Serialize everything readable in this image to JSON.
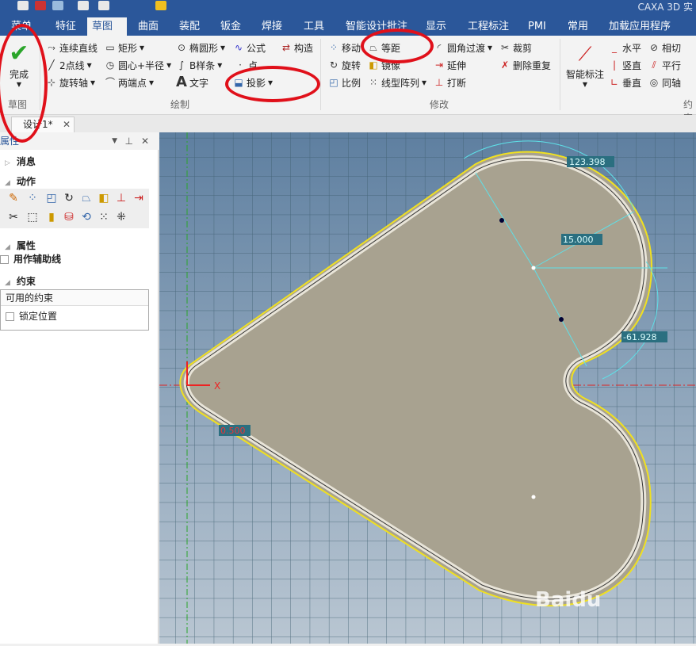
{
  "app": {
    "title": "CAXA 3D 实"
  },
  "menu_tabs": [
    "菜单",
    "特征",
    "草图",
    "曲面",
    "装配",
    "钣金",
    "焊接",
    "工具",
    "智能设计批注",
    "显示",
    "工程标注",
    "PMI",
    "常用",
    "加载应用程序"
  ],
  "ribbon": {
    "finish": "完成",
    "sketch_group": "草图",
    "draw": [
      "连续直线",
      "矩形",
      "椭圆形",
      "公式",
      "构造",
      "2点线",
      "圆心+半径",
      "B样条",
      "点",
      "旋转轴",
      "两端点",
      "文字",
      "投影"
    ],
    "draw_group": "绘制",
    "modify": [
      "移动",
      "等距",
      "圆角过渡",
      "裁剪",
      "旋转",
      "镜像",
      "延伸",
      "删除重复",
      "比例",
      "线型阵列",
      "打断"
    ],
    "modify_group": "修改",
    "smart_dim": "智能标注",
    "constraints": [
      "水平",
      "相切",
      "竖直",
      "平行",
      "垂直",
      "同轴"
    ],
    "constraint_group": "约束"
  },
  "doc_tab": "设计1*",
  "panel": {
    "title": "属性",
    "messages": "消息",
    "actions": "动作",
    "properties": "属性",
    "aux_line": "用作辅助线",
    "constraints": "约束",
    "available": "可用的约束",
    "lock": "锁定位置"
  },
  "dims": {
    "arc": "123.398",
    "radius": "15.000",
    "angle": "-61.928",
    "offset": "0.500"
  },
  "axis": {
    "x": "X"
  },
  "watermark": "Baidu"
}
